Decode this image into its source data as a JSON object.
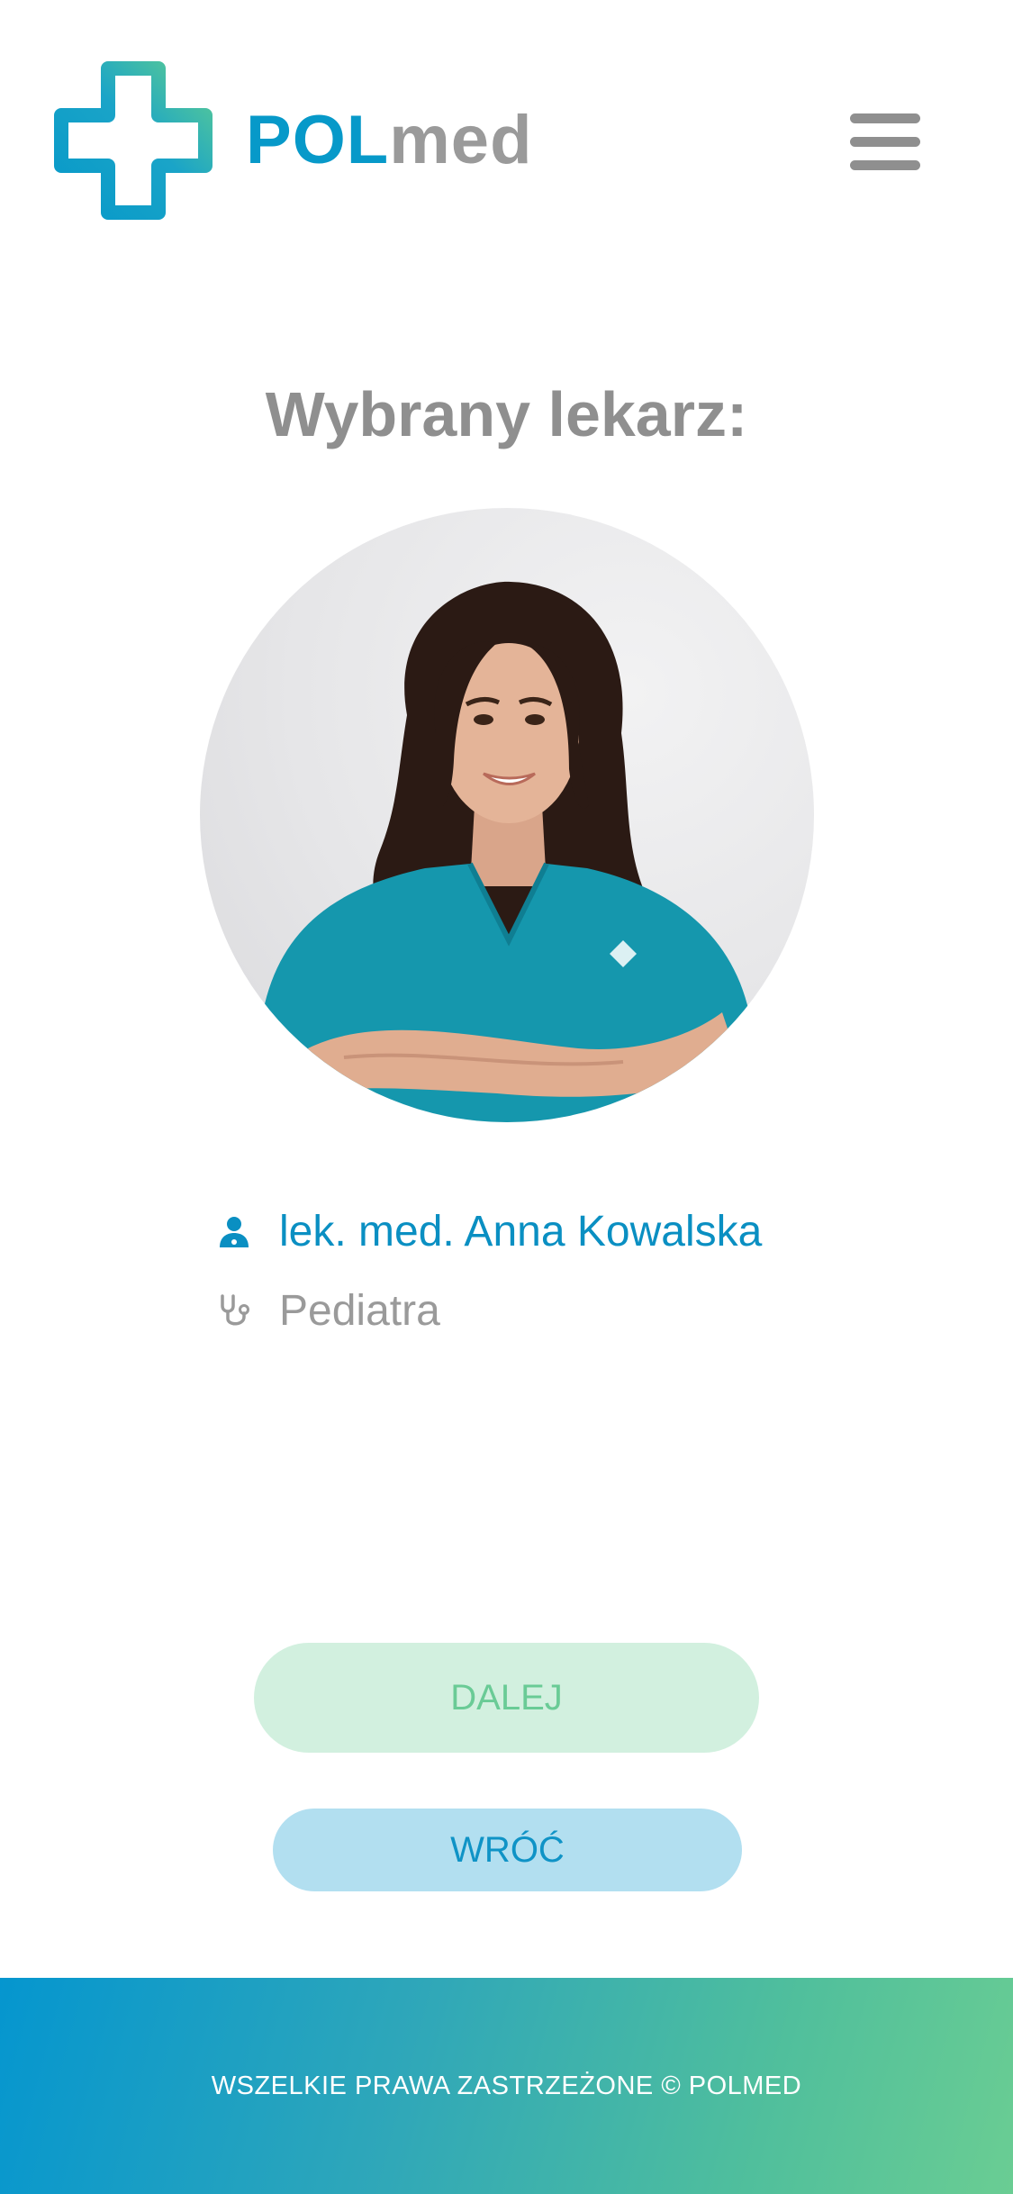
{
  "brand": {
    "name_part1": "POL",
    "name_part2": "med",
    "color_primary": "#0799c9",
    "color_secondary": "#5dcc92",
    "color_text_gray": "#9a9a9a"
  },
  "header": {
    "menu_icon": "hamburger-icon"
  },
  "main": {
    "title": "Wybrany lekarz:",
    "doctor": {
      "photo_icon": "doctor-photo",
      "name_icon": "doctor-person-icon",
      "name": "lek. med. Anna Kowalska",
      "specialty_icon": "stethoscope-icon",
      "specialty": "Pediatra"
    }
  },
  "actions": {
    "next_label": "DALEJ",
    "back_label": "WRÓĆ"
  },
  "footer": {
    "text": "WSZELKIE PRAWA ZASTRZEŻONE © POLMED"
  }
}
